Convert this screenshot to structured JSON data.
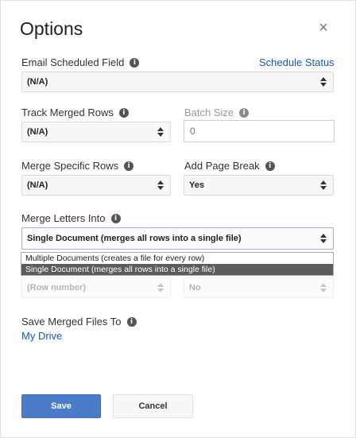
{
  "dialog": {
    "title": "Options",
    "close_glyph": "×"
  },
  "email_field": {
    "label": "Email Scheduled Field",
    "link": "Schedule Status",
    "value": "(N/A)"
  },
  "track_rows": {
    "label": "Track Merged Rows",
    "value": "(N/A)"
  },
  "batch_size": {
    "label": "Batch Size",
    "value": "0"
  },
  "merge_specific": {
    "label": "Merge Specific Rows",
    "value": "(N/A)"
  },
  "page_break": {
    "label": "Add Page Break",
    "value": "Yes"
  },
  "merge_into": {
    "label": "Merge Letters Into",
    "value": "Single Document (merges all rows into a single file)",
    "options": [
      "Multiple Documents (creates a file for every row)",
      "Single Document (merges all rows into a single file)"
    ]
  },
  "hidden_row": {
    "row_number": "(Row number)",
    "no_value": "No"
  },
  "save_to": {
    "label": "Save Merged Files To",
    "link": "My Drive"
  },
  "buttons": {
    "save": "Save",
    "cancel": "Cancel"
  },
  "info_glyph": "i",
  "colors": {
    "primary": "#4a7cc9",
    "link": "#1a57b5",
    "selected_option": "#5c5c5c"
  }
}
